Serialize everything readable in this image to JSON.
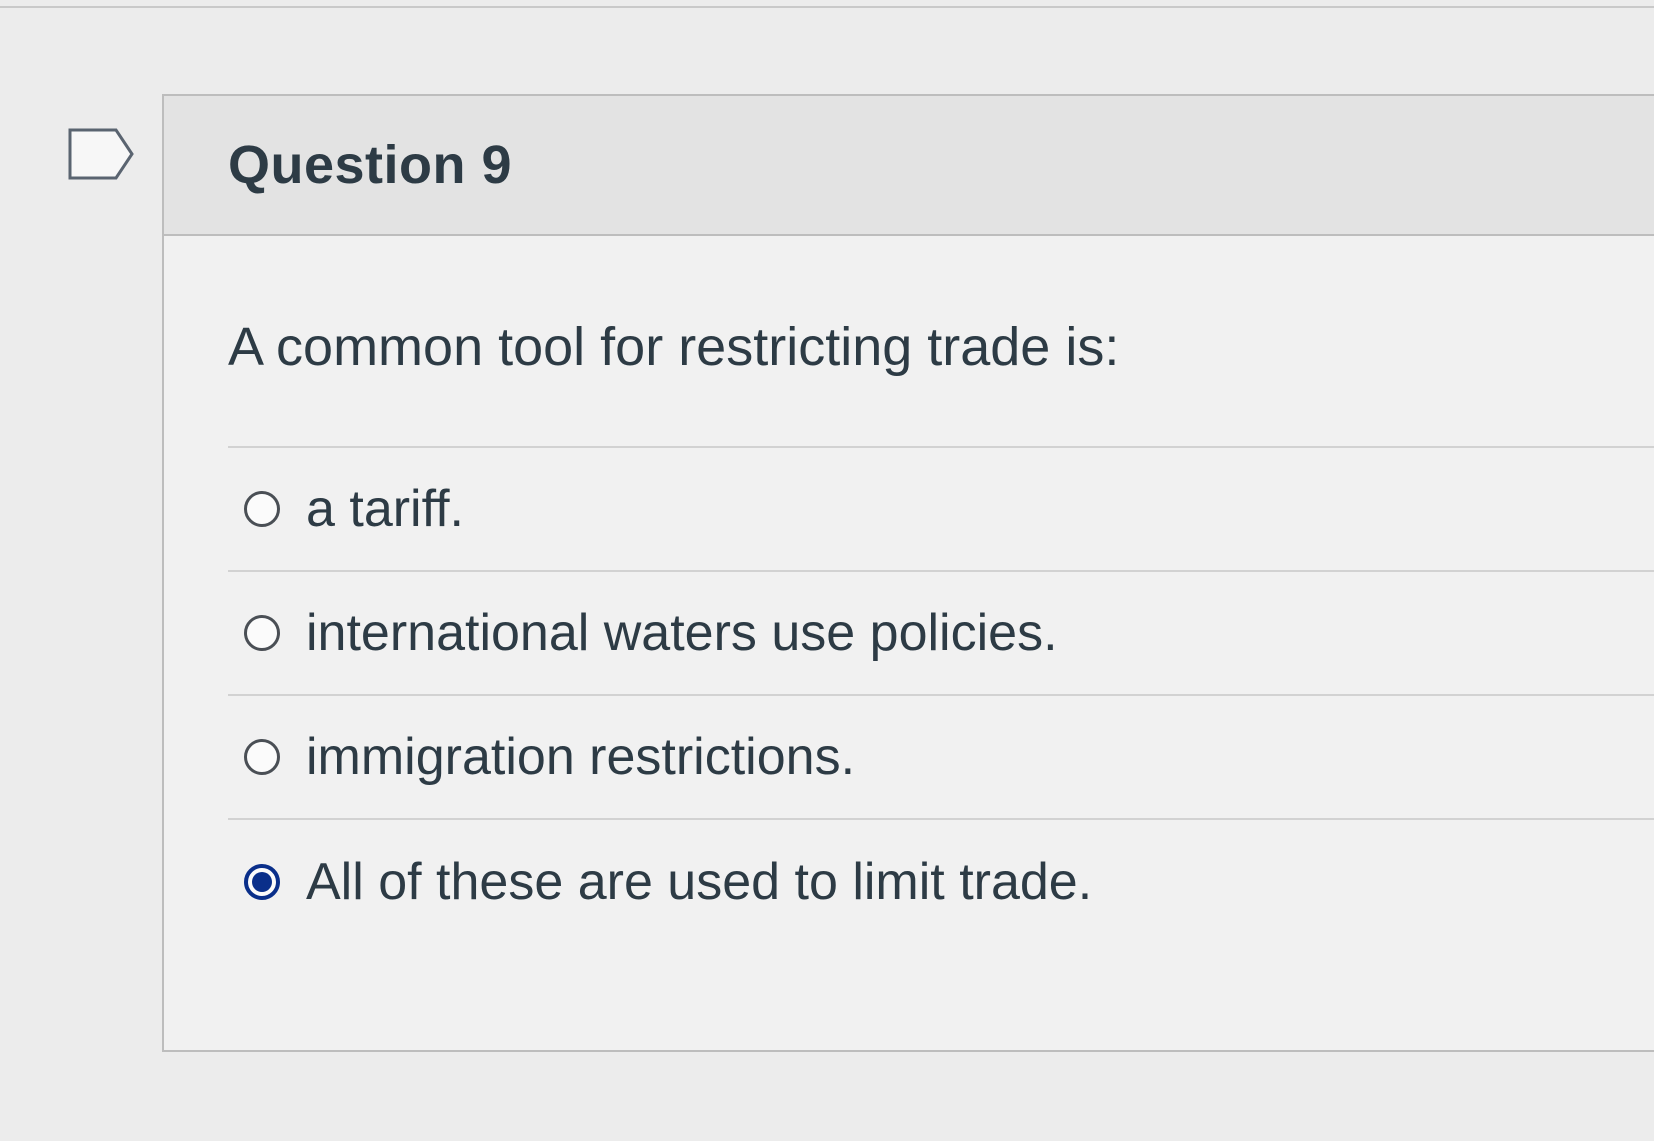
{
  "question": {
    "title": "Question 9",
    "text": "A common tool for restricting trade is:",
    "answers": [
      {
        "label": "a tariff.",
        "selected": false
      },
      {
        "label": "international waters use policies.",
        "selected": false
      },
      {
        "label": "immigration restrictions.",
        "selected": false
      },
      {
        "label": "All of these are used to limit trade.",
        "selected": true
      }
    ]
  },
  "icons": {
    "flag": "flag-question-icon"
  },
  "colors": {
    "selected_radio": "#0a2f8a",
    "text": "#2d3b45"
  }
}
